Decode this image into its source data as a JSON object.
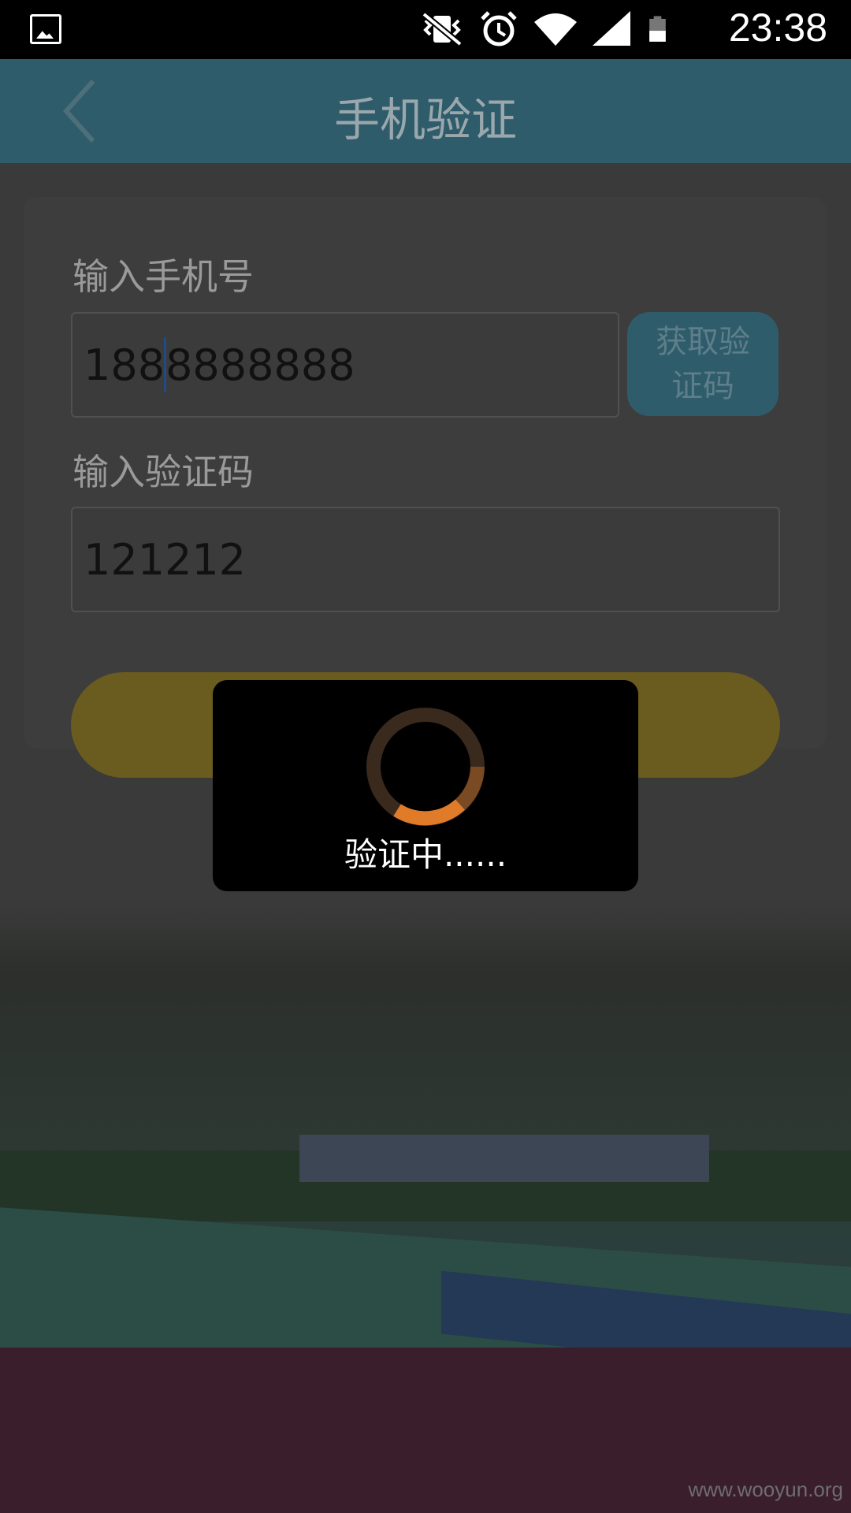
{
  "status_bar": {
    "time": "23:38",
    "icons": [
      "gallery-icon",
      "vibrate-off-icon",
      "alarm-icon",
      "wifi-icon",
      "signal-icon",
      "battery-icon"
    ]
  },
  "app_bar": {
    "title": "手机验证",
    "back_icon": "chevron-left-icon"
  },
  "form": {
    "phone_label": "输入手机号",
    "phone_value_before_caret": "188",
    "phone_value_after_caret": "8888888",
    "get_code_label": "获取验证码",
    "code_label": "输入验证码",
    "code_value": "121212"
  },
  "dialog": {
    "text": "验证中......"
  },
  "watermark": "www.wooyun.org",
  "colors": {
    "status_bar": "#000000",
    "app_bar": "#2f5c6a",
    "submit_button": "#6a5b1f",
    "spinner_accent": "#e07b2a"
  }
}
